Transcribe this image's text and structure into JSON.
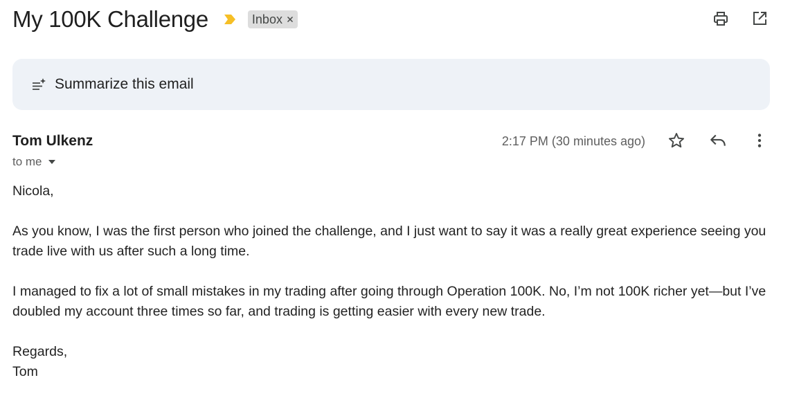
{
  "subject": "My 100K Challenge",
  "label_chip": {
    "text": "Inbox",
    "close_glyph": "×"
  },
  "importance_marker_color": "#f6bf26",
  "summarize": {
    "label": "Summarize this email"
  },
  "message": {
    "sender": "Tom Ulkenz",
    "recipients": "to me",
    "timestamp": "2:17 PM (30 minutes ago)",
    "greeting": "Nicola,",
    "paragraphs": [
      "As you know, I was the first person who joined the challenge, and I just want to say it was a really great experience seeing you trade live with us after such a long time.",
      "I managed to fix a lot of small mistakes in my trading after going through Operation 100K. No, I’m not 100K richer yet—but I’ve doubled my account three times so far, and trading is getting easier with every new trade."
    ],
    "signoff": "Regards,",
    "signature": "Tom"
  },
  "icons": {
    "print": "print-icon",
    "open_new_window": "open-in-new-window-icon",
    "summarize": "summarize-sparkle-icon",
    "star": "star-icon",
    "reply": "reply-icon",
    "more": "more-vert-icon",
    "caret": "caret-down-icon",
    "importance": "importance-marker-icon"
  }
}
